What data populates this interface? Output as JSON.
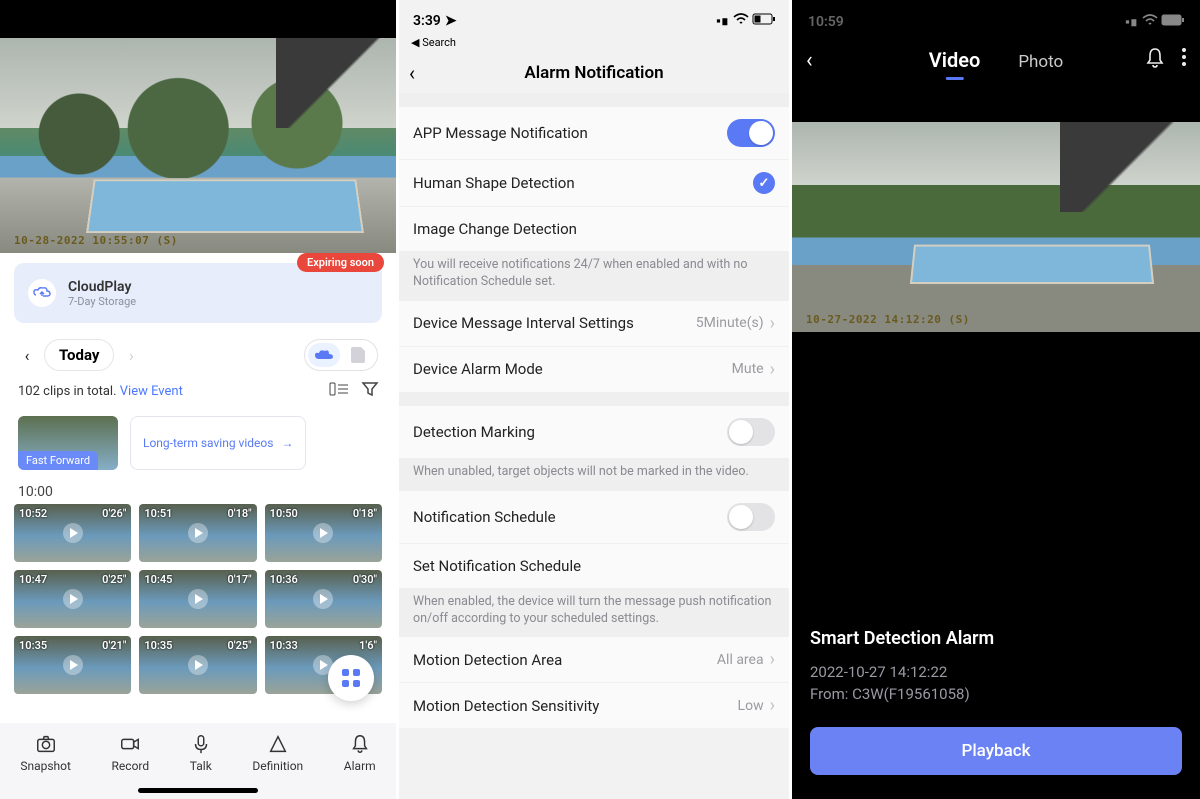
{
  "left": {
    "live_timestamp": "10-28-2022 10:55:07 (S)",
    "cloudplay": {
      "title": "CloudPlay",
      "subtitle": "7-Day Storage",
      "badge": "Expiring soon"
    },
    "date_label": "Today",
    "clip_summary": "102 clips in total. ",
    "view_event": "View Event",
    "fast_forward": "Fast Forward",
    "long_term": "Long-term saving videos",
    "time_header": "10:00",
    "clips": [
      {
        "t": "10:52",
        "d": "0'26\""
      },
      {
        "t": "10:51",
        "d": "0'18\""
      },
      {
        "t": "10:50",
        "d": "0'18\""
      },
      {
        "t": "10:47",
        "d": "0'25\""
      },
      {
        "t": "10:45",
        "d": "0'17\""
      },
      {
        "t": "10:36",
        "d": "0'30\""
      },
      {
        "t": "10:35",
        "d": "0'21\""
      },
      {
        "t": "10:35",
        "d": "0'25\""
      },
      {
        "t": "10:33",
        "d": "1'6\""
      }
    ],
    "bottom": {
      "snapshot": "Snapshot",
      "record": "Record",
      "talk": "Talk",
      "definition": "Definition",
      "alarm": "Alarm"
    }
  },
  "mid": {
    "status_time": "3:39",
    "search_back": "Search",
    "title": "Alarm Notification",
    "app_msg": "APP Message Notification",
    "human_shape": "Human Shape Detection",
    "image_change": "Image Change Detection",
    "image_change_desc": "You will receive notifications 24/7 when enabled and with no Notification Schedule set.",
    "interval_label": "Device Message Interval Settings",
    "interval_value": "5Minute(s)",
    "alarm_mode_label": "Device Alarm Mode",
    "alarm_mode_value": "Mute",
    "detection_marking": "Detection Marking",
    "detection_marking_desc": "When unabled, target objects will not be marked in the video.",
    "notif_schedule": "Notification Schedule",
    "set_notif_schedule": "Set Notification Schedule",
    "set_notif_schedule_desc": "When enabled, the device will turn the message push notification on/off according to your scheduled settings.",
    "motion_area_label": "Motion Detection Area",
    "motion_area_value": "All area",
    "motion_sens_label": "Motion Detection Sensitivity",
    "motion_sens_value": "Low"
  },
  "right": {
    "status_time": "10:59",
    "tab_video": "Video",
    "tab_photo": "Photo",
    "video_timestamp": "10-27-2022 14:12:20 (S)",
    "alarm_title": "Smart Detection Alarm",
    "alarm_time": "2022-10-27 14:12:22",
    "alarm_from": "From: C3W(F19561058)",
    "playback": "Playback"
  }
}
